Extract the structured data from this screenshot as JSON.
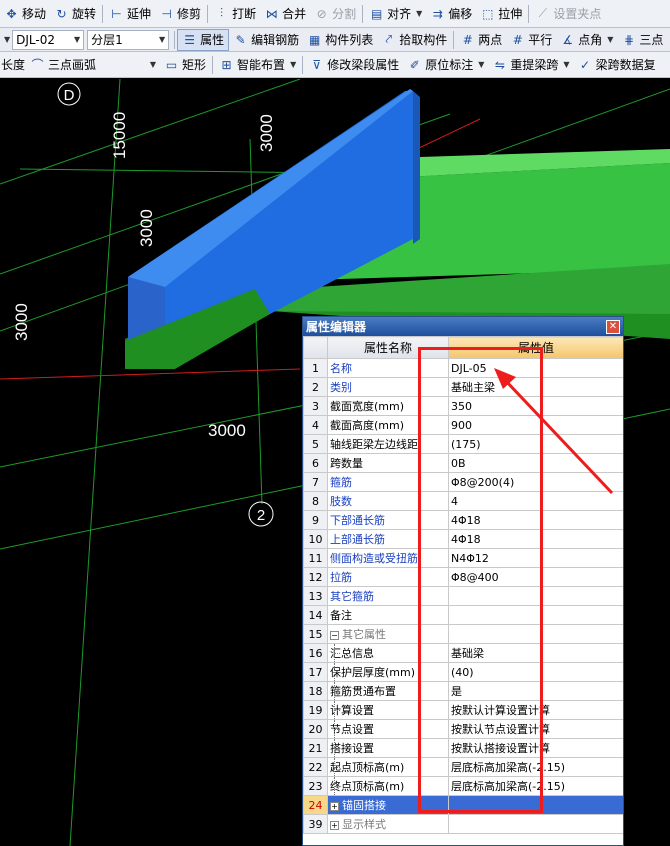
{
  "toolbar1": {
    "move": "移动",
    "rotate": "旋转",
    "extend": "延伸",
    "trim": "修剪",
    "break": "打断",
    "merge": "合并",
    "split": "分割",
    "align": "对齐",
    "offset": "偏移",
    "stretch": "拉伸",
    "set_clamp_point": "设置夹点"
  },
  "toolbar2": {
    "member_select": "DJL-02",
    "layer_select": "分层1",
    "properties": "属性",
    "edit_rebar": "编辑钢筋",
    "member_list": "构件列表",
    "pick_member": "拾取构件",
    "two_points": "两点",
    "parallel": "平行",
    "point_angle": "点角",
    "three_axis": "三点"
  },
  "toolbar3": {
    "length": "长度",
    "three_point_arc": "三点画弧",
    "rectangle": "矩形",
    "smart_layout": "智能布置",
    "modify_beam_props": "修改梁段属性",
    "in_situ_label": "原位标注",
    "re_extract_span": "重提梁跨",
    "span_copy": "梁跨数据复"
  },
  "canvas": {
    "axis_bubble_d": "D",
    "axis_bubble_2": "2",
    "dims": [
      "15000",
      "3000",
      "3000",
      "3000",
      "3000"
    ]
  },
  "dialog": {
    "title": "属性编辑器",
    "col_name": "属性名称",
    "col_value": "属性值",
    "rows": [
      {
        "num": "1",
        "name": "名称",
        "value": "DJL-05"
      },
      {
        "num": "2",
        "name": "类别",
        "value": "基础主梁"
      },
      {
        "num": "3",
        "name": "截面宽度(mm)",
        "value": "350"
      },
      {
        "num": "4",
        "name": "截面高度(mm)",
        "value": "900"
      },
      {
        "num": "5",
        "name": "轴线距梁左边线距",
        "value": "(175)"
      },
      {
        "num": "6",
        "name": "跨数量",
        "value": "0B"
      },
      {
        "num": "7",
        "name": "箍筋",
        "value": "Φ8@200(4)"
      },
      {
        "num": "8",
        "name": "肢数",
        "value": "4"
      },
      {
        "num": "9",
        "name": "下部通长筋",
        "value": "4Φ18"
      },
      {
        "num": "10",
        "name": "上部通长筋",
        "value": "4Φ18"
      },
      {
        "num": "11",
        "name": "侧面构造或受扭筋",
        "value": "N4Φ12"
      },
      {
        "num": "12",
        "name": "拉筋",
        "value": "Φ8@400"
      },
      {
        "num": "13",
        "name": "其它箍筋",
        "value": ""
      },
      {
        "num": "14",
        "name": "备注",
        "value": ""
      },
      {
        "num": "15",
        "name": "其它属性",
        "value": ""
      },
      {
        "num": "16",
        "name": "汇总信息",
        "value": "基础梁"
      },
      {
        "num": "17",
        "name": "保护层厚度(mm)",
        "value": "(40)"
      },
      {
        "num": "18",
        "name": "箍筋贯通布置",
        "value": "是"
      },
      {
        "num": "19",
        "name": "计算设置",
        "value": "按默认计算设置计算"
      },
      {
        "num": "20",
        "name": "节点设置",
        "value": "按默认节点设置计算"
      },
      {
        "num": "21",
        "name": "搭接设置",
        "value": "按默认搭接设置计算"
      },
      {
        "num": "22",
        "name": "起点顶标高(m)",
        "value": "层底标高加梁高(-2.15)"
      },
      {
        "num": "23",
        "name": "终点顶标高(m)",
        "value": "层底标高加梁高(-2.15)"
      },
      {
        "num": "24",
        "name": "锚固搭接",
        "value": ""
      },
      {
        "num": "39",
        "name": "显示样式",
        "value": ""
      }
    ]
  },
  "colors": {
    "highlight_red": "#ee1c1c",
    "beam_blue": "#1f6de0",
    "beam_green": "#33c040"
  }
}
